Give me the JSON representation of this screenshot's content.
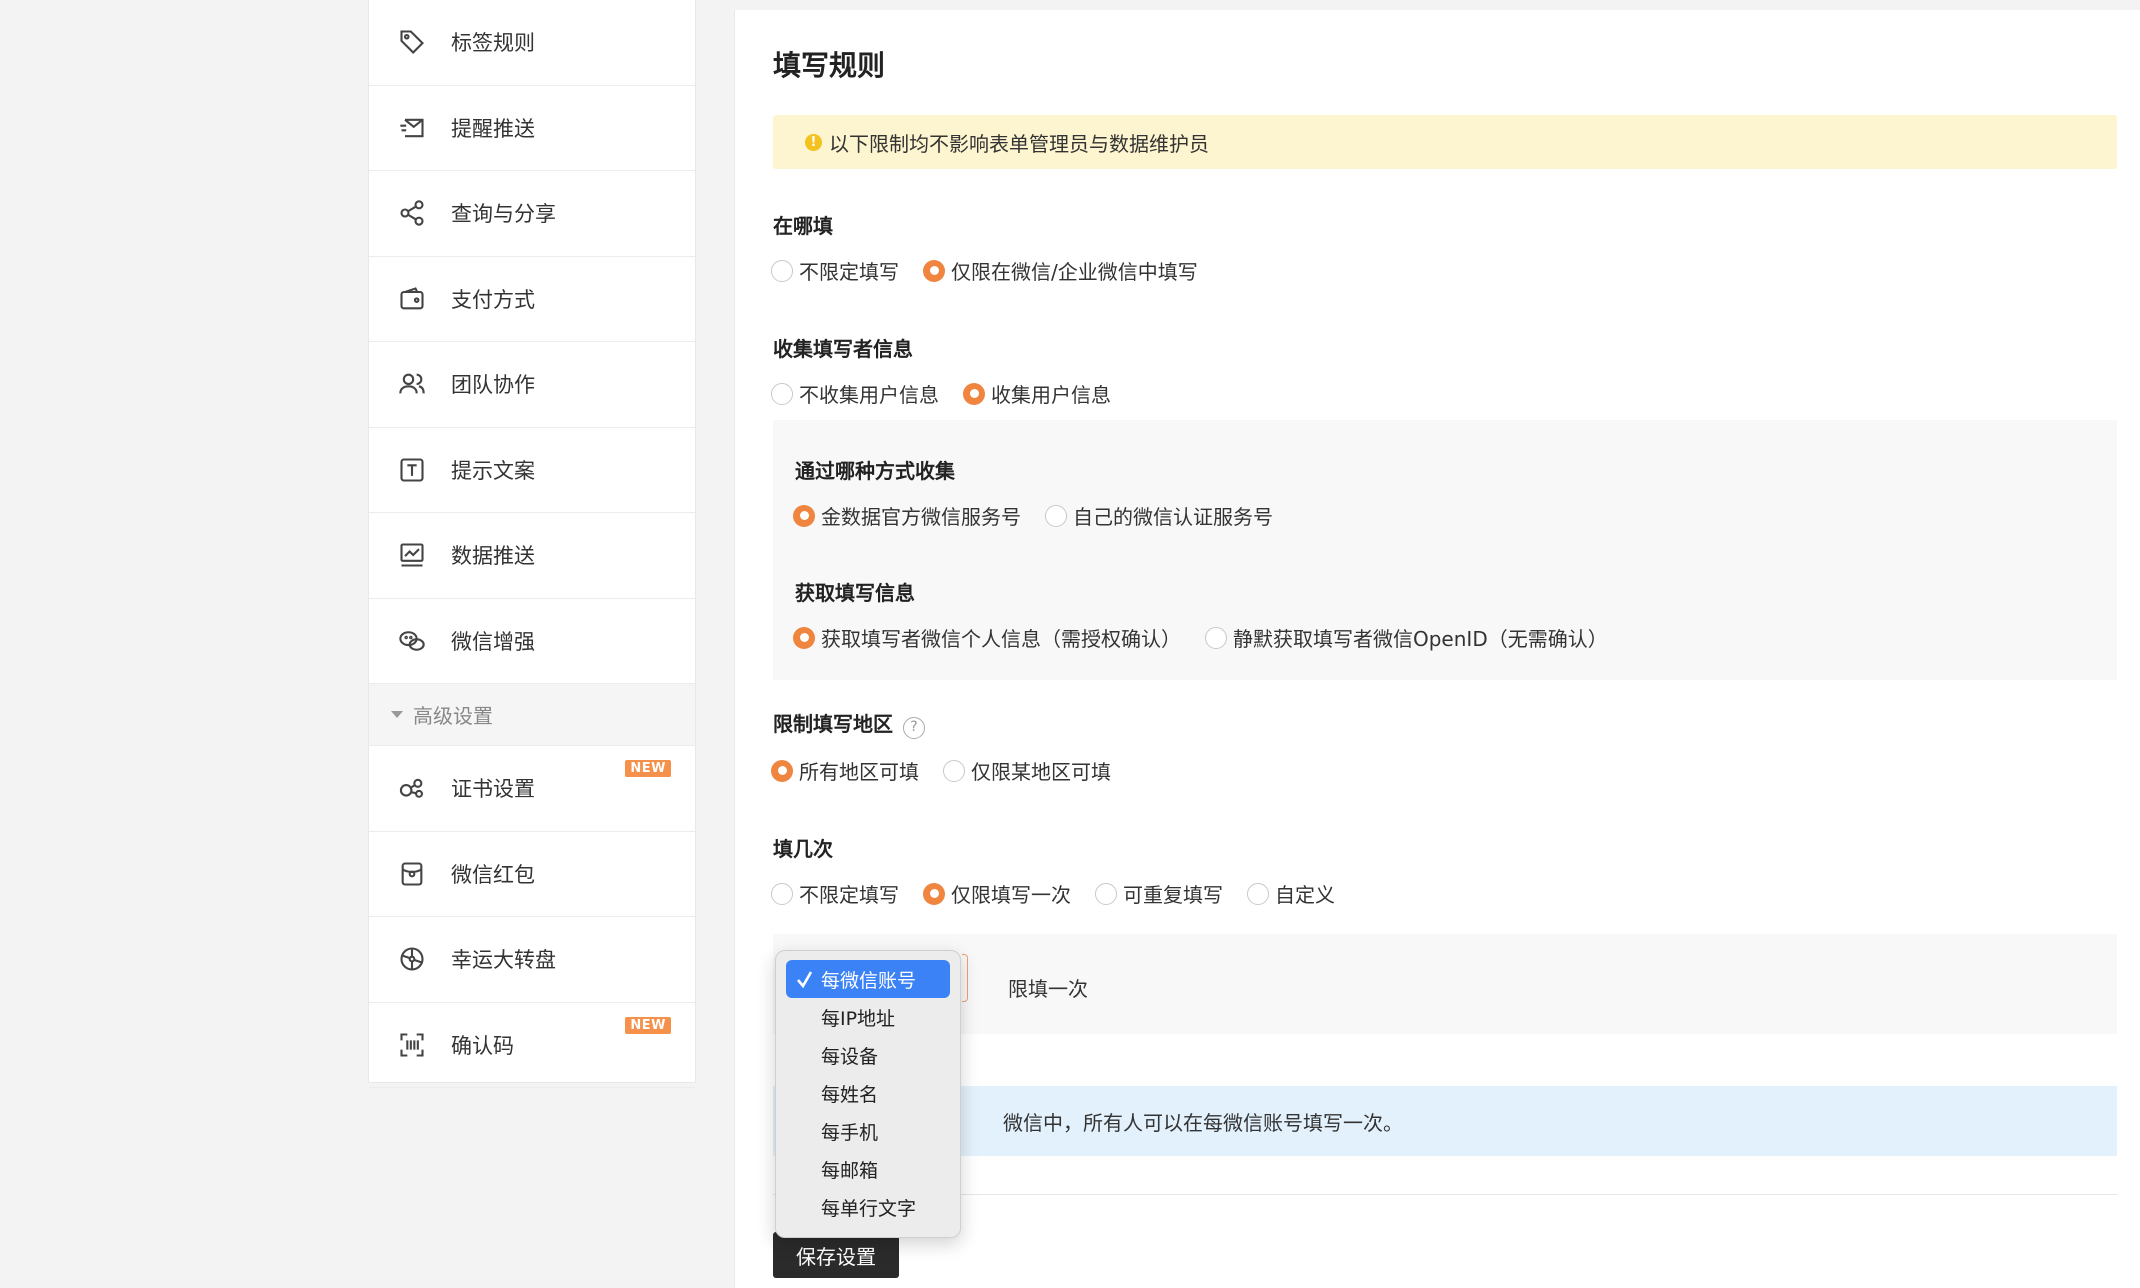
{
  "sidebar": {
    "items": [
      {
        "label": "标签规则",
        "icon": "tag-icon"
      },
      {
        "label": "提醒推送",
        "icon": "mail-send-icon"
      },
      {
        "label": "查询与分享",
        "icon": "share-icon"
      },
      {
        "label": "支付方式",
        "icon": "wallet-icon"
      },
      {
        "label": "团队协作",
        "icon": "team-icon"
      },
      {
        "label": "提示文案",
        "icon": "text-box-icon"
      },
      {
        "label": "数据推送",
        "icon": "chart-line-icon"
      },
      {
        "label": "微信增强",
        "icon": "wechat-icon"
      }
    ],
    "advanced_section": "高级设置",
    "advanced_items": [
      {
        "label": "证书设置",
        "icon": "certificate-icon",
        "badge": "NEW"
      },
      {
        "label": "微信红包",
        "icon": "red-packet-icon"
      },
      {
        "label": "幸运大转盘",
        "icon": "wheel-icon"
      },
      {
        "label": "确认码",
        "icon": "scan-code-icon",
        "badge": "NEW"
      }
    ]
  },
  "main": {
    "title": "填写规则",
    "notice": "以下限制均不影响表单管理员与数据维护员",
    "where": {
      "label": "在哪填",
      "options": [
        "不限定填写",
        "仅限在微信/企业微信中填写"
      ],
      "selected": 1
    },
    "collect": {
      "label": "收集填写者信息",
      "options": [
        "不收集用户信息",
        "收集用户信息"
      ],
      "selected": 1,
      "method_label": "通过哪种方式收集",
      "method_options": [
        "金数据官方微信服务号",
        "自己的微信认证服务号"
      ],
      "method_selected": 0,
      "info_label": "获取填写信息",
      "info_options": [
        "获取填写者微信个人信息（需授权确认）",
        "静默获取填写者微信OpenID（无需确认）"
      ],
      "info_selected": 0
    },
    "region": {
      "label": "限制填写地区",
      "help_icon": "question-circle-icon",
      "options": [
        "所有地区可填",
        "仅限某地区可填"
      ],
      "selected": 0
    },
    "times": {
      "label": "填几次",
      "options": [
        "不限定填写",
        "仅限填写一次",
        "可重复填写",
        "自定义"
      ],
      "selected": 1,
      "limit_suffix": "限填一次"
    },
    "info_text": "微信中，所有人可以在每微信账号填写一次。",
    "save_label": "保存设置"
  },
  "dropdown": {
    "options": [
      "每微信账号",
      "每IP地址",
      "每设备",
      "每姓名",
      "每手机",
      "每邮箱",
      "每单行文字"
    ],
    "selected": "每微信账号"
  },
  "colors": {
    "accent": "#f08540",
    "notice_bg": "#fdf5cf",
    "info_bg": "#e3f1fc",
    "select_blue": "#3a82f6",
    "save_bg": "#2b2b2b"
  }
}
